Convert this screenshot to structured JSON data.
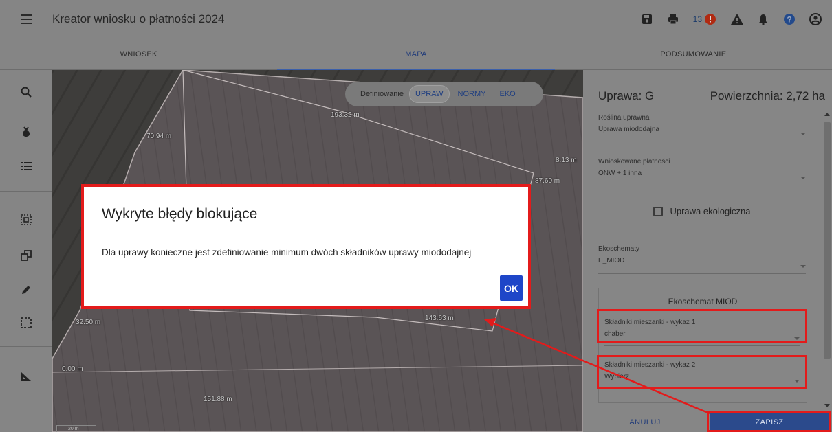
{
  "header": {
    "title": "Kreator wniosku o płatności 2024",
    "notification_count": "13",
    "icons": [
      "save-icon",
      "print-icon",
      "error-icon",
      "warning-icon",
      "bell-icon",
      "help-icon",
      "account-icon"
    ]
  },
  "tabs": [
    {
      "label": "WNIOSEK",
      "active": false
    },
    {
      "label": "MAPA",
      "active": true
    },
    {
      "label": "PODSUMOWANIE",
      "active": false
    }
  ],
  "toolbar": {
    "icons": [
      "search-icon",
      "plant-icon",
      "list-icon",
      "select-area-icon",
      "copy-shape-icon",
      "edit-pencil-icon",
      "dashed-select-icon",
      "measure-icon"
    ]
  },
  "map": {
    "segment": {
      "label": "Definiowanie",
      "options": [
        "UPRAW",
        "NORMY",
        "EKO"
      ],
      "active": "UPRAW"
    },
    "labels": {
      "l1": "70.94 m",
      "l2": "193.32 m",
      "l3": "8.13 m",
      "l4": "87.60 m",
      "l5": "32.50 m",
      "l6": "143.63 m",
      "l7": "151.88 m",
      "l8": "0.00 m",
      "scale": "20 m"
    }
  },
  "panel": {
    "crop_label": "Uprawa: G",
    "area_label": "Powierzchnia: 2,72 ha",
    "fields": {
      "plant": {
        "label": "Roślina uprawna",
        "value": "Uprawa miododajna"
      },
      "payments": {
        "label": "Wnioskowane płatności",
        "value": "ONW + 1 inna"
      },
      "ecoschemes": {
        "label": "Ekoschematy",
        "value": "E_MIOD"
      }
    },
    "organic_checkbox": "Uprawa ekologiczna",
    "eko_section": {
      "title": "Ekoschemat MIOD",
      "mix1": {
        "label": "Składniki mieszanki - wykaz 1",
        "value": "chaber"
      },
      "mix2": {
        "label": "Składniki mieszanki - wykaz 2",
        "value": "Wybierz"
      }
    },
    "buttons": {
      "cancel": "ANULUJ",
      "save": "ZAPISZ"
    }
  },
  "dialog": {
    "title": "Wykryte błędy blokujące",
    "message": "Dla uprawy konieczne jest zdefiniowanie minimum dwóch składników uprawy miododajnej",
    "ok": "OK"
  },
  "colors": {
    "highlight": "#e31b1b",
    "primary": "#1e46c8",
    "save_button": "#2b4a8c"
  }
}
